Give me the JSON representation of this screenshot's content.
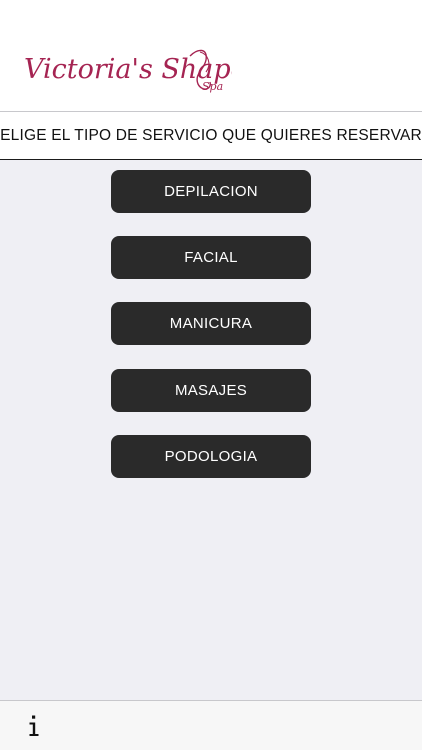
{
  "header": {
    "logo_text": "Victoria's Shapes",
    "logo_suffix": "Spa",
    "logo_color": "#a52452"
  },
  "subtitle": "ELIGE EL TIPO DE SERVICIO QUE QUIERES RESERVAR",
  "services": [
    {
      "label": "DEPILACION"
    },
    {
      "label": "FACIAL"
    },
    {
      "label": "MANICURA"
    },
    {
      "label": "MASAJES"
    },
    {
      "label": "PODOLOGIA"
    }
  ],
  "bottom_bar": {
    "info_icon": "info-icon"
  },
  "colors": {
    "background": "#efeff4",
    "button": "#2a2a2a",
    "button_text": "#ffffff"
  }
}
